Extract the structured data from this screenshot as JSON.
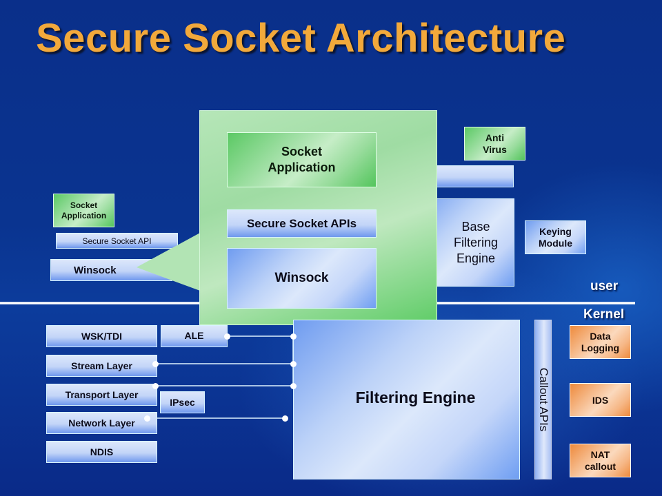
{
  "slide": {
    "title": "Secure Socket Architecture"
  },
  "user_mode": {
    "small_stack": {
      "socket_application": "Socket\nApplication",
      "secure_socket_api": "Secure Socket API",
      "winsock": "Winsock"
    },
    "zoom_callout": {
      "socket_application": "Socket\nApplication",
      "secure_socket_apis": "Secure Socket APIs",
      "winsock": "Winsock"
    },
    "anti_virus": "Anti\nVirus",
    "base_filtering_engine": "Base\nFiltering\nEngine",
    "keying_module": "Keying\nModule",
    "user_label": "user"
  },
  "kernel_mode": {
    "kernel_label": "Kernel",
    "layers": [
      "WSK/TDI",
      "Stream Layer",
      "Transport Layer",
      "Network Layer",
      "NDIS"
    ],
    "ale": "ALE",
    "ipsec": "IPsec",
    "filtering_engine": "Filtering Engine",
    "callout_apis": "Callout APIs",
    "callouts": [
      "Data\nLogging",
      "IDS",
      "NAT\ncallout"
    ]
  }
}
